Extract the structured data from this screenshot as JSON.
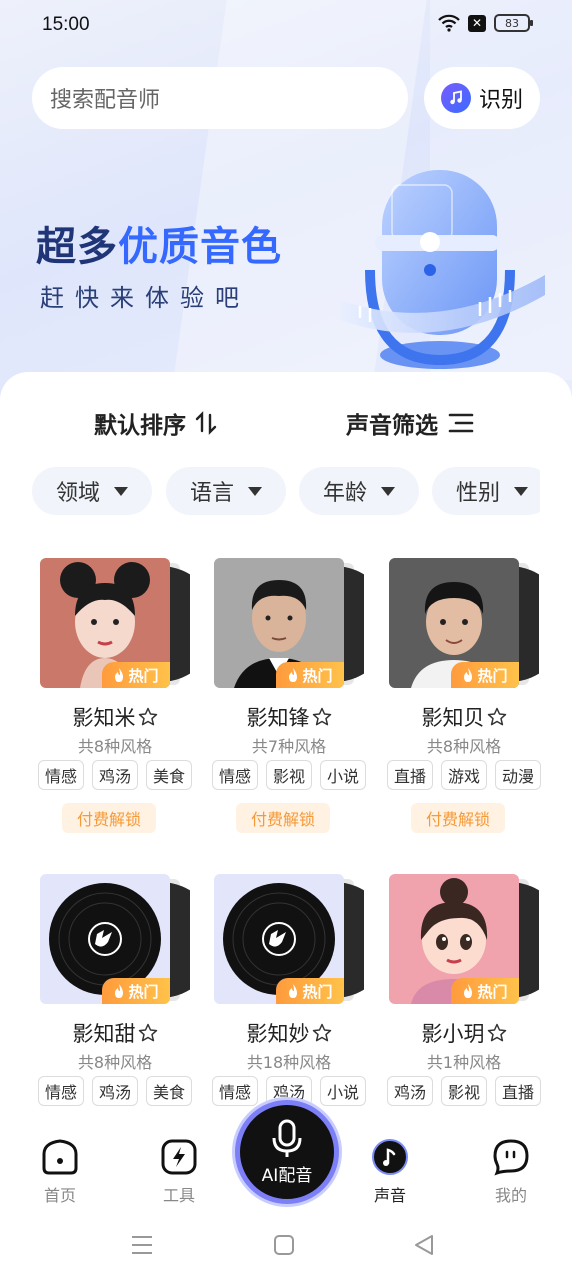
{
  "status_bar": {
    "time": "15:00",
    "battery": "83"
  },
  "search": {
    "placeholder": "搜索配音师",
    "recognize_label": "识别"
  },
  "banner": {
    "title_part1": "超多",
    "title_part2": "优质音色",
    "subtitle": "赶快来体验吧"
  },
  "sort": {
    "default_label": "默认排序",
    "filter_label": "声音筛选"
  },
  "filters": [
    "领域",
    "语言",
    "年龄",
    "性别"
  ],
  "hot_label": "热门",
  "voices": [
    {
      "name": "影知米",
      "styles": "共8种风格",
      "tags": [
        "情感",
        "鸡汤",
        "美食"
      ],
      "unlock": "付费解锁",
      "cover": "girl"
    },
    {
      "name": "影知锋",
      "styles": "共7种风格",
      "tags": [
        "情感",
        "影视",
        "小说"
      ],
      "unlock": "付费解锁",
      "cover": "man"
    },
    {
      "name": "影知贝",
      "styles": "共8种风格",
      "tags": [
        "直播",
        "游戏",
        "动漫"
      ],
      "unlock": "付费解锁",
      "cover": "boy"
    },
    {
      "name": "影知甜",
      "styles": "共8种风格",
      "tags": [
        "情感",
        "鸡汤",
        "美食"
      ],
      "cover": "vinyl"
    },
    {
      "name": "影知妙",
      "styles": "共18种风格",
      "tags": [
        "情感",
        "鸡汤",
        "小说"
      ],
      "cover": "vinyl"
    },
    {
      "name": "影小玥",
      "styles": "共1种风格",
      "tags": [
        "鸡汤",
        "影视",
        "直播"
      ],
      "cover": "cartoon"
    }
  ],
  "bottom_nav": {
    "home": "首页",
    "tools": "工具",
    "ai": "AI配音",
    "voice": "声音",
    "mine": "我的"
  },
  "colors": {
    "accent": "#3568ff",
    "hot_badge": "#ffa53f",
    "unlock_text": "#f59a38"
  }
}
